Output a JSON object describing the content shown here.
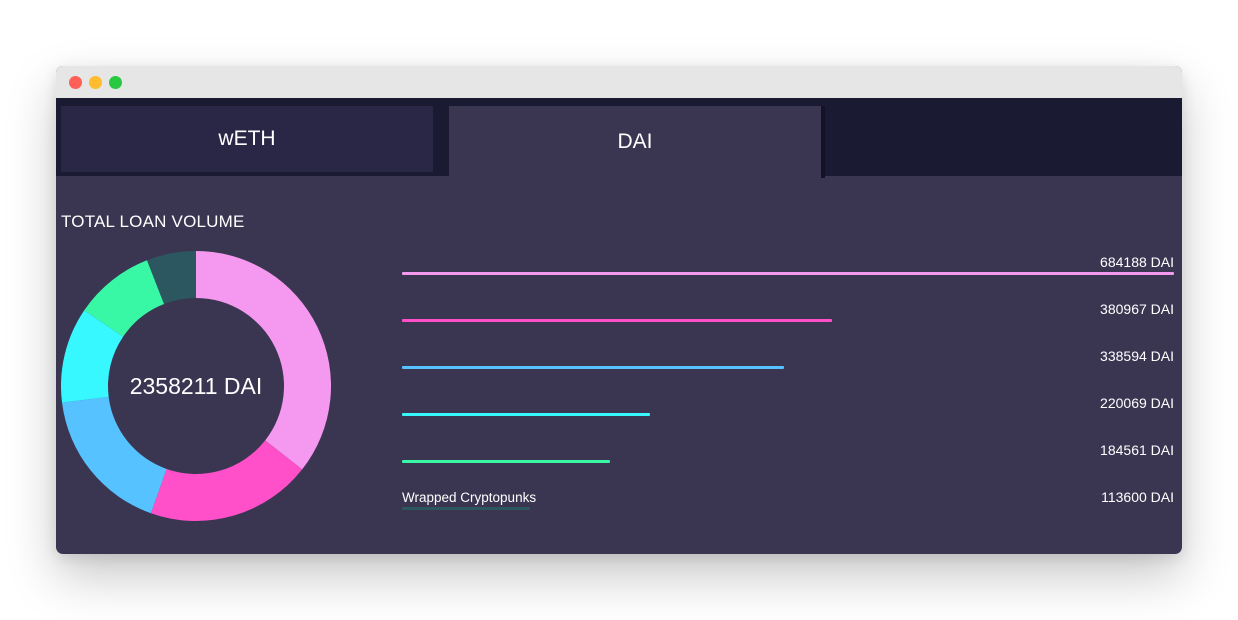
{
  "tabs": [
    {
      "label": "wETH"
    },
    {
      "label": "DAI"
    }
  ],
  "active_tab": "DAI",
  "section_title": "TOTAL LOAN VOLUME",
  "donut": {
    "center_label": "2358211 DAI"
  },
  "colors": {
    "background": "#3a3652",
    "tab_bar": "#1b1a33",
    "segments": [
      "#f598ef",
      "#ff4fc9",
      "#56c2ff",
      "#38f8ff",
      "#38f8a5",
      "#2c5760"
    ]
  },
  "bar_rows": [
    {
      "value_text": "684188 DAI",
      "label": ""
    },
    {
      "value_text": "380967 DAI",
      "label": ""
    },
    {
      "value_text": "338594 DAI",
      "label": ""
    },
    {
      "value_text": "220069 DAI",
      "label": ""
    },
    {
      "value_text": "184561 DAI",
      "label": ""
    },
    {
      "value_text": "113600 DAI",
      "label": "Wrapped Cryptopunks"
    }
  ],
  "chart_data": {
    "type": "bar",
    "title": "TOTAL LOAN VOLUME",
    "total_label": "2358211 DAI",
    "categories": [
      "",
      "",
      "",
      "",
      "",
      "Wrapped Cryptopunks"
    ],
    "values": [
      684188,
      380967,
      338594,
      220069,
      184561,
      113600
    ],
    "unit": "DAI"
  }
}
